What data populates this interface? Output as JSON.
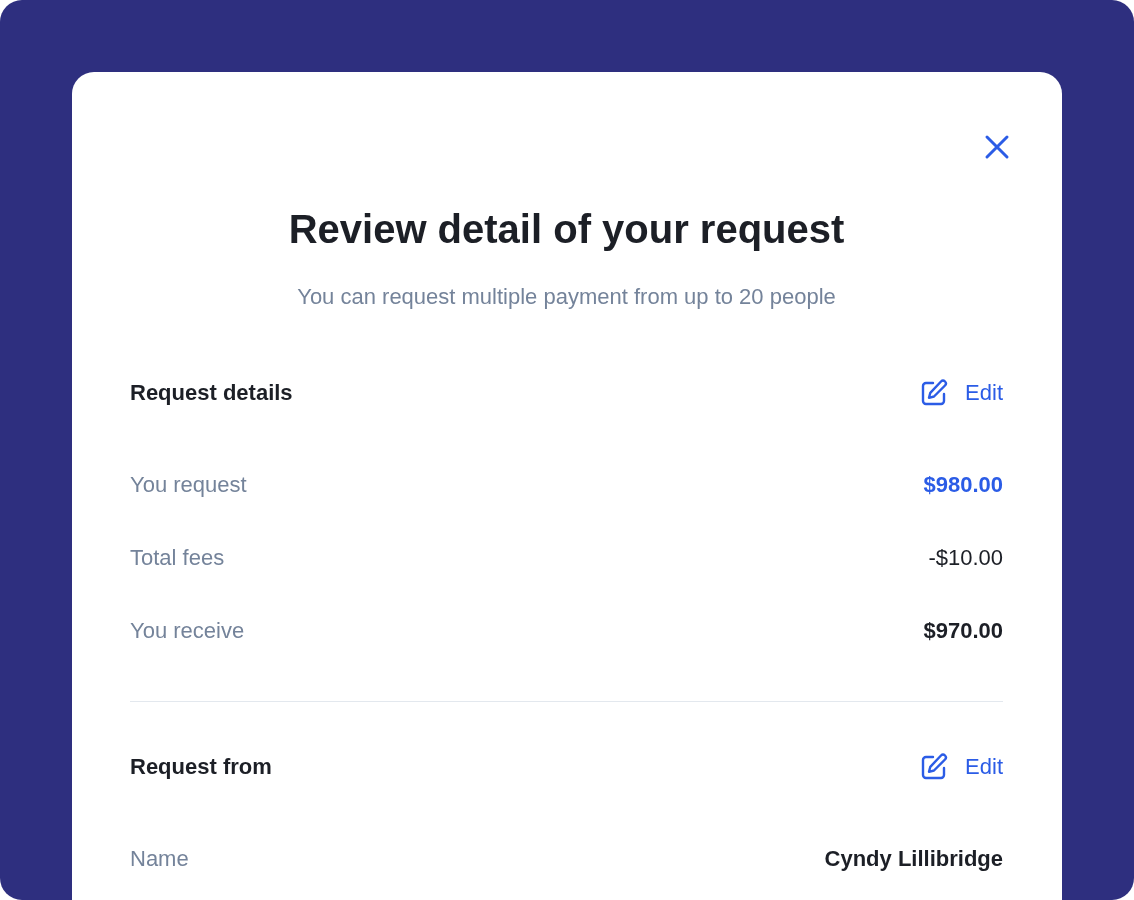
{
  "dialog": {
    "title": "Review detail of your request",
    "subtitle": "You can request multiple payment from up to 20 people"
  },
  "sections": [
    {
      "heading": "Request details",
      "edit_label": "Edit",
      "rows": [
        {
          "label": "You request",
          "value": "$980.00",
          "kind": "accent"
        },
        {
          "label": "Total fees",
          "value": "-$10.00",
          "kind": "plain"
        },
        {
          "label": "You receive",
          "value": "$970.00",
          "kind": "strong"
        }
      ]
    },
    {
      "heading": "Request from",
      "edit_label": "Edit",
      "rows": [
        {
          "label": "Name",
          "value": "Cyndy Lillibridge",
          "kind": "strong"
        }
      ]
    }
  ]
}
